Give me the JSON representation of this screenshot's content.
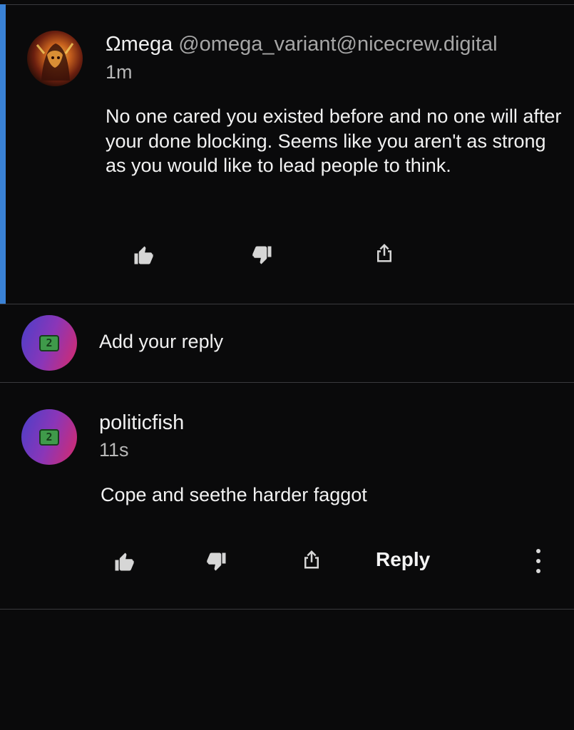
{
  "post": {
    "display_name": "Ωmega",
    "handle": "@omega_variant@nicecrew.digital",
    "time": "1m",
    "text": "No one cared you existed before and no one will after your done blocking. Seems like you aren't as strong as you would like to lead people to think.",
    "avatar_icon": "omega-avatar",
    "actions": [
      "thumbs-up-icon",
      "thumbs-down-icon",
      "share-icon"
    ]
  },
  "composer": {
    "placeholder": "Add your reply",
    "avatar_icon": "user-avatar-logo"
  },
  "reply": {
    "display_name": "politicfish",
    "time": "11s",
    "text": "Cope and seethe harder faggot",
    "reply_label": "Reply",
    "actions": [
      "thumbs-up-icon",
      "thumbs-down-icon",
      "share-icon",
      "more-vertical-icon"
    ]
  },
  "colors": {
    "background": "#0a0a0b",
    "accent": "#3a82d6",
    "divider": "#3a3a3e"
  }
}
